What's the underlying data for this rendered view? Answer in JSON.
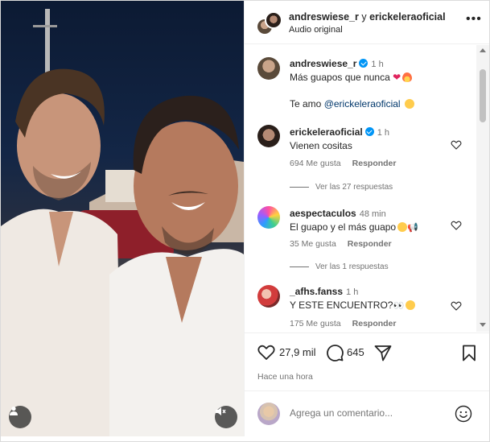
{
  "header": {
    "user1": "andreswiese_r",
    "connector": "y",
    "user2": "erickeleraoficial",
    "subtitle": "Audio original",
    "more_icon": "more-horizontal-icon"
  },
  "comments": [
    {
      "username": "andreswiese_r",
      "time": "1 h",
      "line1": "Más guapos que nunca",
      "line2_prefix": "Te amo",
      "mention": "@erickeleraoficial"
    },
    {
      "username": "erickeleraoficial",
      "time": "1 h",
      "text": "Vienen cositas",
      "likes": "694 Me gusta",
      "reply": "Responder",
      "view_replies": "Ver las 27 respuestas"
    },
    {
      "username": "aespectaculos",
      "time": "48 min",
      "text": "El guapo y el más guapo",
      "likes": "35 Me gusta",
      "reply": "Responder",
      "view_replies": "Ver las 1 respuestas"
    },
    {
      "username": "_afhs.fanss",
      "time": "1 h",
      "text": "Y ESTE ENCUENTRO?",
      "likes": "175 Me gusta",
      "reply": "Responder"
    }
  ],
  "actions": {
    "likes_count": "27,9 mil",
    "comments_count": "645",
    "time_ago": "Hace una hora"
  },
  "add_comment": {
    "placeholder": "Agrega un comentario..."
  },
  "colors": {
    "link": "#00376b",
    "verified": "#0095f6",
    "muted": "#737373",
    "text": "#262626"
  }
}
